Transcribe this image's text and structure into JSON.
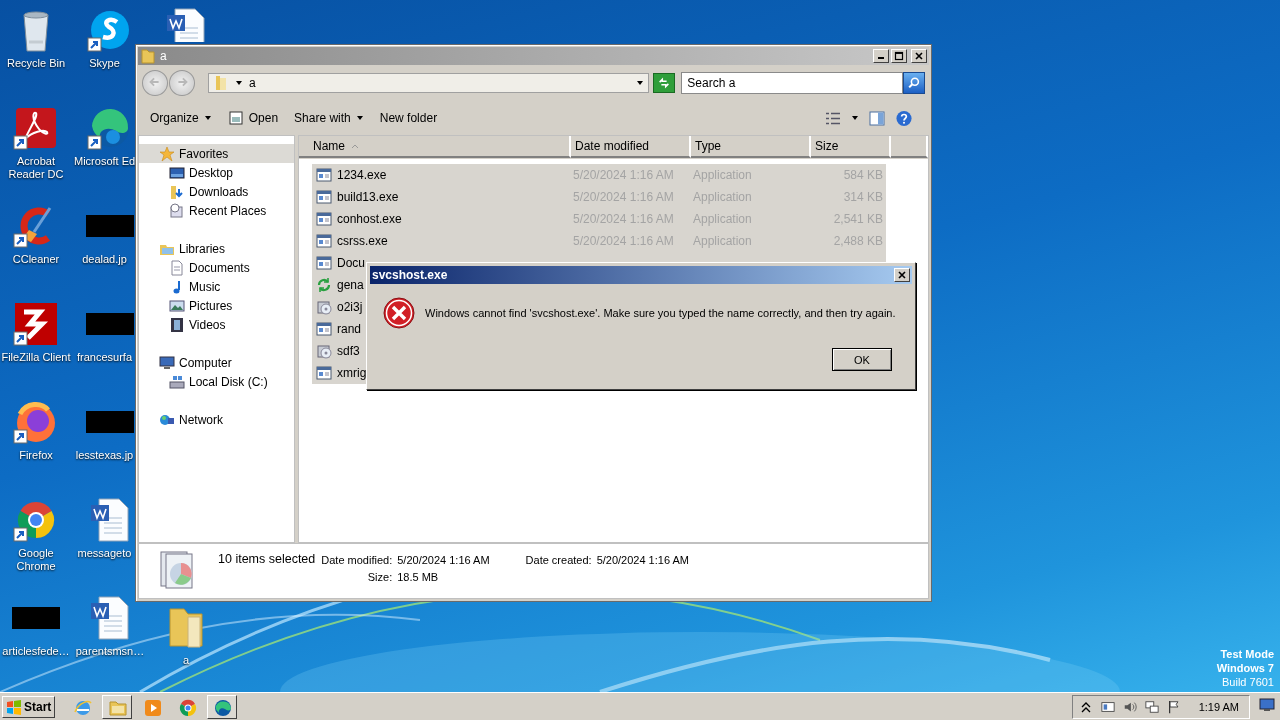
{
  "desktop_columns": [
    [
      {
        "label": "Recycle Bin",
        "kind": "recycle",
        "shortcut": false
      },
      {
        "label": "Acrobat Reader DC",
        "kind": "acrobat",
        "shortcut": true
      },
      {
        "label": "CCleaner",
        "kind": "ccleaner",
        "shortcut": true
      },
      {
        "label": "FileZilla Client",
        "kind": "filezilla",
        "shortcut": true
      },
      {
        "label": "Firefox",
        "kind": "firefox",
        "shortcut": true
      },
      {
        "label": "Google Chrome",
        "kind": "chrome",
        "shortcut": true
      },
      {
        "label": "articlesfede…",
        "kind": "image"
      }
    ],
    [
      {
        "label": "Skype",
        "kind": "skype",
        "shortcut": true
      },
      {
        "label": "Microsoft Ed",
        "kind": "edge",
        "shortcut": true
      },
      {
        "label": "dealad.jp",
        "kind": "image"
      },
      {
        "label": "francesurfa",
        "kind": "image"
      },
      {
        "label": "lesstexas.jp",
        "kind": "image"
      },
      {
        "label": "messageto",
        "kind": "word",
        "shortcut": false
      },
      {
        "label": "parentsmsn…",
        "kind": "word",
        "shortcut": false
      }
    ],
    [
      {
        "kind": "word",
        "shortcut": false
      },
      {
        "label": "a",
        "kind": "folder",
        "shortcut": false
      }
    ]
  ],
  "explorer": {
    "title": "a",
    "address": "a",
    "search": {
      "placeholder": "Search a"
    },
    "toolbar": [
      {
        "label": "Organize",
        "kind": "menu"
      },
      {
        "label": "Open",
        "kind": "open"
      },
      {
        "label": "Share with",
        "kind": "menu"
      },
      {
        "label": "New folder",
        "kind": "plain"
      }
    ],
    "nav": [
      {
        "label": "Favorites",
        "kind": "star",
        "selected": true,
        "children": [
          {
            "label": "Desktop",
            "kind": "desktop",
            "selected": false
          },
          {
            "label": "Downloads",
            "kind": "downloads",
            "selected": false
          },
          {
            "label": "Recent Places",
            "kind": "recent",
            "selected": false
          }
        ]
      },
      {
        "label": "Libraries",
        "kind": "libraries",
        "selected": false,
        "children": [
          {
            "label": "Documents",
            "kind": "documents",
            "selected": false
          },
          {
            "label": "Music",
            "kind": "music",
            "selected": false
          },
          {
            "label": "Pictures",
            "kind": "pictures",
            "selected": false
          },
          {
            "label": "Videos",
            "kind": "videos",
            "selected": false
          }
        ]
      },
      {
        "label": "Computer",
        "kind": "computer",
        "selected": false,
        "children": [
          {
            "label": "Local Disk (C:)",
            "kind": "disk",
            "selected": false
          }
        ]
      },
      {
        "label": "Network",
        "kind": "network",
        "selected": false
      }
    ],
    "columns": [
      {
        "label": "Name",
        "sorted": true
      },
      {
        "label": "Date modified",
        "sorted": false
      },
      {
        "label": "Type",
        "sorted": false
      },
      {
        "label": "Size",
        "sorted": false
      }
    ],
    "files": [
      {
        "name": "1234.exe",
        "date": "5/20/2024 1:16 AM",
        "type": "Application",
        "size": "584 KB",
        "kind": "app",
        "selected": true
      },
      {
        "name": "build13.exe",
        "date": "5/20/2024 1:16 AM",
        "type": "Application",
        "size": "314 KB",
        "kind": "app",
        "selected": true
      },
      {
        "name": "conhost.exe",
        "date": "5/20/2024 1:16 AM",
        "type": "Application",
        "size": "2,541 KB",
        "kind": "app",
        "selected": true
      },
      {
        "name": "csrss.exe",
        "date": "5/20/2024 1:16 AM",
        "type": "Application",
        "size": "2,488 KB",
        "kind": "app",
        "selected": true
      },
      {
        "name": "Docu",
        "kind": "app",
        "selected": true
      },
      {
        "name": "gena",
        "kind": "sync",
        "selected": true
      },
      {
        "name": "o2i3j",
        "kind": "installer",
        "selected": true
      },
      {
        "name": "rand",
        "kind": "app",
        "selected": true
      },
      {
        "name": "sdf3",
        "kind": "installer",
        "selected": true
      },
      {
        "name": "xmrig",
        "kind": "app",
        "selected": true
      }
    ],
    "details": {
      "summary": "10 items selected",
      "properties": [
        {
          "label": "Date modified:",
          "value": "5/20/2024 1:16 AM"
        },
        {
          "label": "Size:",
          "value": "18.5 MB"
        },
        {
          "label": "Date created:",
          "value": "5/20/2024 1:16 AM"
        }
      ]
    }
  },
  "dialog": {
    "title": "svcshost.exe",
    "message": "Windows cannot find 'svcshost.exe'. Make sure you typed the name correctly, and then try again.",
    "button": "OK"
  },
  "os_notice": [
    {
      "text": "Test Mode",
      "bold": true
    },
    {
      "text": "Windows 7",
      "bold": true
    },
    {
      "text": "Build 7601",
      "bold": false
    }
  ],
  "taskbar": {
    "start": "Start",
    "apps": [
      {
        "kind": "ie",
        "open": false
      },
      {
        "kind": "explorer",
        "open": true
      },
      {
        "kind": "media",
        "open": false
      },
      {
        "kind": "chrome",
        "open": false
      },
      {
        "kind": "edge",
        "open": true
      }
    ],
    "clock": "1:19 AM"
  }
}
